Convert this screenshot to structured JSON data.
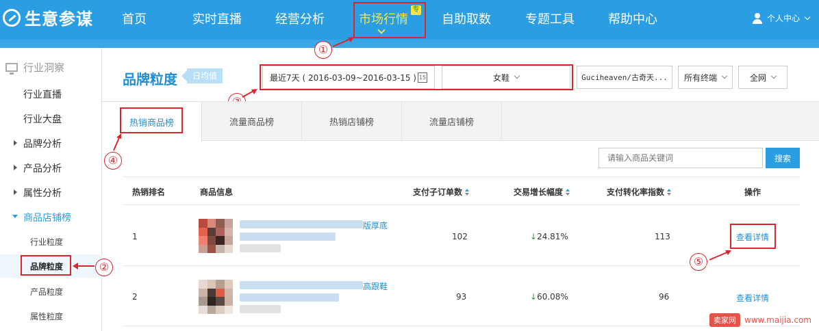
{
  "brand": {
    "name": "生意参谋"
  },
  "nav": {
    "items": [
      "首页",
      "实时直播",
      "经营分析",
      "市场行情",
      "自助取数",
      "专题工具",
      "帮助中心"
    ],
    "badge": "专",
    "user": "个人中心"
  },
  "sidebar": {
    "section": "行业洞察",
    "items": [
      "行业直播",
      "行业大盘",
      "品牌分析",
      "产品分析",
      "属性分析",
      "商品店铺榜"
    ],
    "sub_items": [
      "行业粒度",
      "品牌粒度",
      "产品粒度",
      "属性粒度"
    ]
  },
  "page": {
    "title": "品牌粒度",
    "tag": "日均值"
  },
  "filters": {
    "date": "最近7天 ( 2016-03-09~2016-03-15 )",
    "calendar": "15",
    "category": "女鞋",
    "brand": "Guciheaven/古奇天...",
    "terminal": "所有终端",
    "network": "全网"
  },
  "tabs": [
    "热销商品榜",
    "流量商品榜",
    "热销店铺榜",
    "流量店铺榜"
  ],
  "search": {
    "placeholder": "请输入商品关键词",
    "button": "搜索"
  },
  "table": {
    "headers": [
      "热销排名",
      "商品信息",
      "支付子订单数",
      "交易增长幅度",
      "支付转化率指数",
      "操作"
    ],
    "rows": [
      {
        "rank": "1",
        "title_tail": "版厚底",
        "orders": "102",
        "growth": "24.81%",
        "conversion": "113",
        "action": "查看详情"
      },
      {
        "rank": "2",
        "title_tail": "高跟鞋",
        "orders": "93",
        "growth": "60.08%",
        "conversion": "96",
        "action": "查看详情"
      }
    ]
  },
  "annotations": [
    "①",
    "②",
    "③",
    "④",
    "⑤"
  ],
  "watermark": {
    "badge": "卖家网",
    "url": "www.maijia.com"
  },
  "colors": {
    "topbar": "#2a9de3",
    "active_nav": "#f5e64b",
    "highlight": "#d9262c",
    "link": "#1e8fd6"
  }
}
